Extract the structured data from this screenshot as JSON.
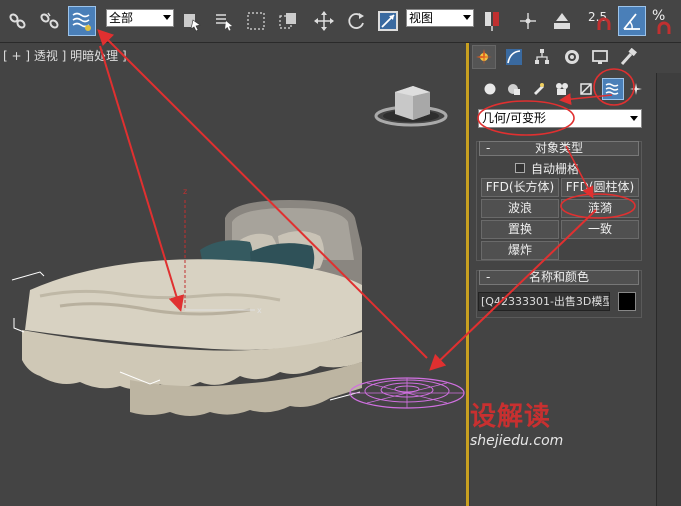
{
  "toolbar": {
    "selection_filter": "全部",
    "reference_coord": "视图",
    "snap_value": "2.5",
    "percent_label": "%"
  },
  "viewport": {
    "label": "[ + ] 透视 ] 明暗处理 ]"
  },
  "panel": {
    "category_select": "几何/可变形",
    "object_type": {
      "title": "对象类型",
      "autogrid_label": "自动栅格",
      "buttons": [
        "FFD(长方体)",
        "FFD(圆柱体)",
        "波浪",
        "涟漪",
        "置换",
        "一致",
        "爆炸"
      ]
    },
    "name_color": {
      "title": "名称和颜色",
      "name_value": "[Q42333301-出售3D模型"
    }
  },
  "watermark": {
    "main": "设解读",
    "sub": "shejiedu.com"
  },
  "colors": {
    "accent_blue": "#4a7fb8",
    "annotation_red": "#e03030",
    "gizmo_magenta": "#d070e0"
  }
}
